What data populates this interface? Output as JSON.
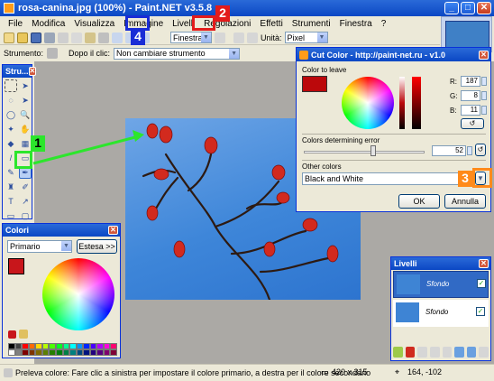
{
  "window": {
    "title": "rosa-canina.jpg (100%) - Paint.NET v3.5.8",
    "min": "_",
    "max": "□",
    "close": "✕"
  },
  "menu": [
    "File",
    "Modifica",
    "Visualizza",
    "Immagine",
    "Livelli",
    "Regolazioni",
    "Effetti",
    "Strumenti",
    "Finestra",
    "?"
  ],
  "toolbar": {
    "window_mode": "Finestra",
    "units_label": "Unità:",
    "units_value": "Pixel"
  },
  "toolbar2": {
    "tool_label": "Strumento:",
    "after_click_label": "Dopo il clic:",
    "after_click_value": "Non cambiare strumento"
  },
  "tools_panel": {
    "title": "Stru..."
  },
  "colors_panel": {
    "title": "Colori",
    "primary_select": "Primario",
    "more_button": "Estesa >>",
    "primary_color": "#c8161b",
    "palette": [
      "#000000",
      "#404040",
      "#ff0000",
      "#ff6a00",
      "#ffd800",
      "#b6ff00",
      "#4cff00",
      "#00ff21",
      "#00ff90",
      "#00ffff",
      "#0094ff",
      "#0026ff",
      "#4800ff",
      "#b200ff",
      "#ff00dc",
      "#ff006e",
      "#ffffff",
      "#808080",
      "#7f0000",
      "#7f3300",
      "#7f6a00",
      "#5b7f00",
      "#267f00",
      "#007f0e",
      "#007f46",
      "#007f7f",
      "#004a7f",
      "#00137f",
      "#21007f",
      "#57007f",
      "#7f006e",
      "#7f0037"
    ]
  },
  "layers_panel": {
    "title": "Livelli",
    "layers": [
      {
        "name": "Sfondo",
        "checked": "✓"
      },
      {
        "name": "Sfondo",
        "checked": "✓"
      }
    ]
  },
  "cut_color": {
    "title": "Cut Color - http://paint-net.ru - v1.0",
    "color_to_leave": "Color to leave",
    "r_label": "R:",
    "r_value": "187",
    "g_label": "G:",
    "g_value": "8",
    "b_label": "B:",
    "b_value": "11",
    "error_label": "Colors determining error",
    "error_value": "52",
    "other_label": "Other colors",
    "other_value": "Black and White",
    "ok": "OK",
    "cancel": "Annulla",
    "swatch": "#bb080b"
  },
  "status": {
    "hint": "Preleva colore: Fare clic a sinistra per impostare il colore primario, a destra per il colore secondario",
    "size": "420 x 315",
    "coords": "164, -102"
  },
  "markers": {
    "m1": "1",
    "m2": "2",
    "m3": "3",
    "m4": "4"
  }
}
